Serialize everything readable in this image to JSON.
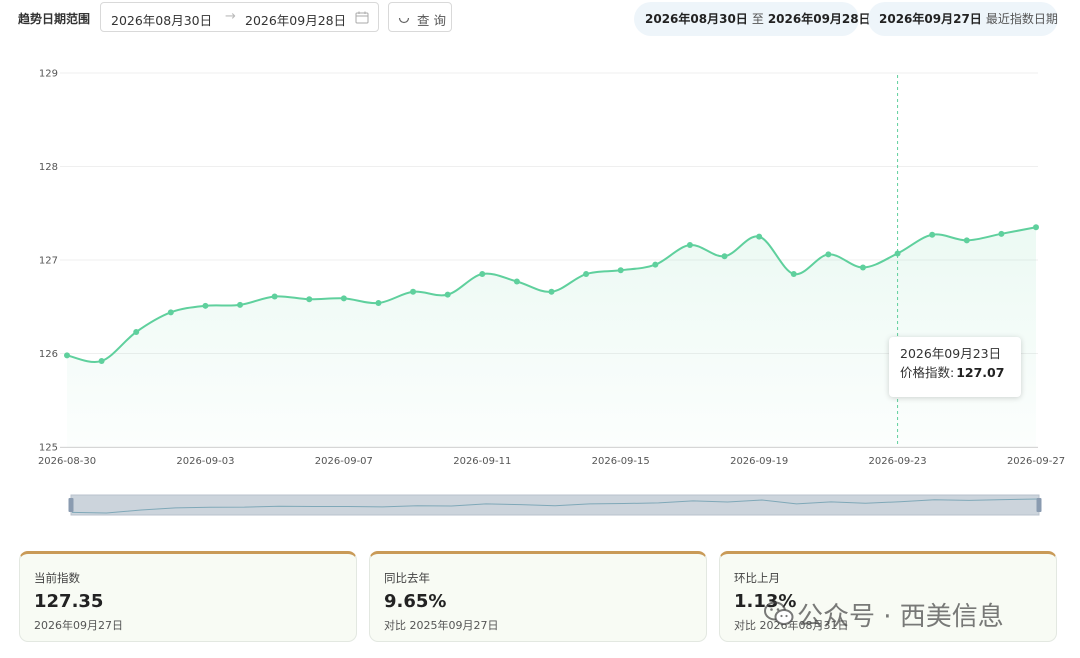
{
  "filter": {
    "label": "趋势日期范围",
    "start_date": "2026年08月30日",
    "separator": "→",
    "end_date": "2026年09月28日",
    "calendar_icon": "calendar-icon",
    "query_icon": "loading-icon",
    "query_label": "查询"
  },
  "summary": {
    "range_start": "2026年08月30日",
    "range_joiner": "至",
    "range_end": "2026年09月28日",
    "latest_date": "2026年09月27日",
    "latest_label": "最近指数日期"
  },
  "tooltip": {
    "date": "2026年09月23日",
    "label": "价格指数:",
    "value": "127.07"
  },
  "cards": [
    {
      "title": "当前指数",
      "value": "127.35",
      "sub": "2026年09月27日"
    },
    {
      "title": "同比去年",
      "value": "9.65%",
      "sub": "对比 2025年09月27日"
    },
    {
      "title": "环比上月",
      "value": "1.13%",
      "sub": "对比 2026年08月31日"
    }
  ],
  "watermark": {
    "icon": "wechat-icon",
    "text": "公众号 · 西美信息"
  },
  "colors": {
    "line": "#5fd09d",
    "accent": "#c99a57",
    "pill_bg": "#eef5fa",
    "card_bg": "#f8fbf4"
  },
  "chart_data": {
    "type": "area",
    "title": "",
    "xlabel": "",
    "ylabel": "",
    "ylim": [
      125,
      129
    ],
    "y_ticks": [
      125,
      126,
      127,
      128,
      129
    ],
    "grid": true,
    "x": [
      "2026-08-30",
      "2026-08-31",
      "2026-09-01",
      "2026-09-02",
      "2026-09-03",
      "2026-09-04",
      "2026-09-05",
      "2026-09-06",
      "2026-09-07",
      "2026-09-08",
      "2026-09-09",
      "2026-09-10",
      "2026-09-11",
      "2026-09-12",
      "2026-09-13",
      "2026-09-14",
      "2026-09-15",
      "2026-09-16",
      "2026-09-17",
      "2026-09-18",
      "2026-09-19",
      "2026-09-20",
      "2026-09-21",
      "2026-09-22",
      "2026-09-23",
      "2026-09-24",
      "2026-09-25",
      "2026-09-26",
      "2026-09-27"
    ],
    "x_tick_labels": [
      "2026-08-30",
      "2026-09-03",
      "2026-09-07",
      "2026-09-11",
      "2026-09-15",
      "2026-09-19",
      "2026-09-23",
      "2026-09-27"
    ],
    "series": [
      {
        "values": [
          125.98,
          125.92,
          126.23,
          126.44,
          126.51,
          126.52,
          126.61,
          126.58,
          126.59,
          126.54,
          126.66,
          126.63,
          126.85,
          126.77,
          126.66,
          126.85,
          126.89,
          126.95,
          127.16,
          127.04,
          127.25,
          126.85,
          127.06,
          126.92,
          127.07,
          127.27,
          127.21,
          127.28,
          127.35
        ]
      }
    ],
    "highlight": "2026-09-23"
  }
}
